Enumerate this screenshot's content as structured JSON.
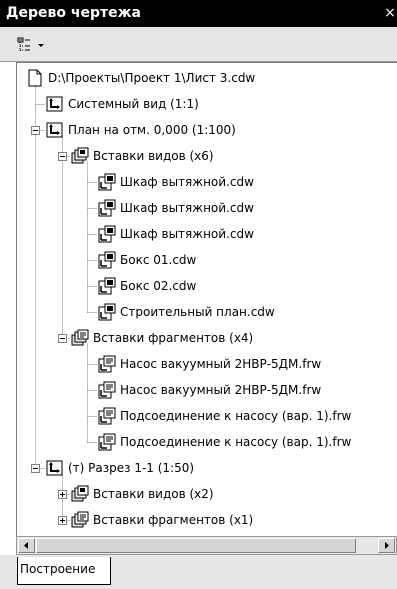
{
  "window": {
    "title": "Дерево чертежа",
    "close_glyph": "×"
  },
  "toolbar": {
    "view_button_icon": "tree-view-icon",
    "dropdown_icon": "chevron-down-icon"
  },
  "tree": {
    "items": [
      {
        "label": "D:\\Проекты\\Проект 1\\Лист 3.cdw",
        "icon": "document-icon",
        "expander": "none"
      },
      {
        "label": "Системный вид (1:1)",
        "icon": "view-icon",
        "expander": "none"
      },
      {
        "label": "План на отм. 0,000 (1:100)",
        "icon": "view-icon",
        "expander": "expanded"
      },
      {
        "label": "Вставки видов (x6)",
        "icon": "view-inserts-icon",
        "expander": "expanded"
      },
      {
        "label": "Шкаф вытяжной.cdw",
        "icon": "drawing-insert-icon",
        "expander": "none"
      },
      {
        "label": "Шкаф вытяжной.cdw",
        "icon": "drawing-insert-icon",
        "expander": "none"
      },
      {
        "label": "Шкаф вытяжной.cdw",
        "icon": "drawing-insert-icon",
        "expander": "none"
      },
      {
        "label": "Бокс 01.cdw",
        "icon": "drawing-insert-icon",
        "expander": "none"
      },
      {
        "label": "Бокс 02.cdw",
        "icon": "drawing-insert-icon",
        "expander": "none"
      },
      {
        "label": "Строительный план.cdw",
        "icon": "drawing-insert-icon",
        "expander": "none"
      },
      {
        "label": "Вставки фрагментов (x4)",
        "icon": "fragment-inserts-icon",
        "expander": "expanded"
      },
      {
        "label": "Насос вакуумный 2НВР-5ДМ.frw",
        "icon": "fragment-insert-icon",
        "expander": "none"
      },
      {
        "label": "Насос вакуумный 2НВР-5ДМ.frw",
        "icon": "fragment-insert-icon",
        "expander": "none"
      },
      {
        "label": "Подсоединение к насосу (вар. 1).frw",
        "icon": "fragment-insert-icon",
        "expander": "none"
      },
      {
        "label": "Подсоединение к насосу (вар. 1).frw",
        "icon": "fragment-insert-icon",
        "expander": "none"
      },
      {
        "label": "(т) Разрез 1-1 (1:50)",
        "icon": "view-icon",
        "expander": "expanded"
      },
      {
        "label": "Вставки видов (x2)",
        "icon": "view-inserts-icon",
        "expander": "collapsed"
      },
      {
        "label": "Вставки фрагментов (x1)",
        "icon": "fragment-inserts-icon",
        "expander": "collapsed"
      }
    ]
  },
  "scrollbar": {
    "left_icon": "arrow-left-icon",
    "right_icon": "arrow-right-icon"
  },
  "tabs": [
    {
      "label": "Построение"
    }
  ]
}
